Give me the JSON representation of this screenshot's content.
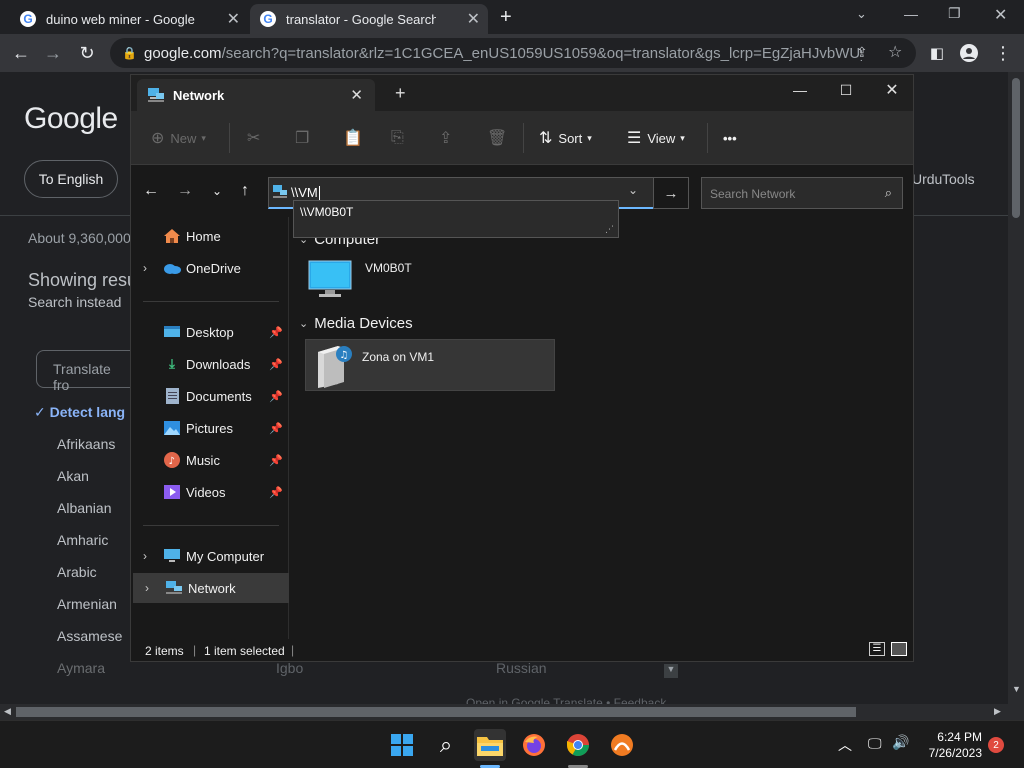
{
  "browser": {
    "tabs": [
      {
        "label": "duino web miner - Google Search"
      },
      {
        "label": "translator - Google Search"
      }
    ],
    "url_host": "google.com",
    "url_rest": "/search?q=translator&rlz=1C1GCEA_enUS1059US1059&oq=translator&gs_lcrp=EgZjaHJvbWUyBgg..."
  },
  "google": {
    "logo": "Google",
    "to_english": "To English",
    "about": "About 9,360,000",
    "showing": "Showing resu",
    "search_instead": "Search instead",
    "translate_placeholder": "Translate fro",
    "detect": "Detect lang",
    "languages": [
      "Afrikaans",
      "Akan",
      "Albanian",
      "Amharic",
      "Arabic",
      "Armenian",
      "Assamese",
      "Aymara"
    ],
    "urdu": "Urdu",
    "tools": "Tools",
    "igbo": "Igbo",
    "russian": "Russian",
    "footer": "Open in Google Translate  •  Feedback"
  },
  "explorer": {
    "tab_title": "Network",
    "cmd": {
      "new": "New",
      "sort": "Sort",
      "view": "View",
      "more": "•••"
    },
    "address_value": "\\\\VM",
    "address_suggestion": "\\\\VM0B0T",
    "search_placeholder": "Search Network",
    "nav": {
      "home": "Home",
      "onedrive": "OneDrive",
      "desktop": "Desktop",
      "downloads": "Downloads",
      "documents": "Documents",
      "pictures": "Pictures",
      "music": "Music",
      "videos": "Videos",
      "my_computer": "My Computer",
      "network": "Network"
    },
    "groups": {
      "computer": "Computer",
      "media": "Media Devices"
    },
    "items": {
      "computer": "VM0B0T",
      "media": "Zona on VM1"
    },
    "status": {
      "count": "2 items",
      "selected": "1 item selected"
    }
  },
  "taskbar": {
    "time": "6:24 PM",
    "date": "7/26/2023",
    "badge": "2"
  },
  "colors": {
    "accent": "#6cb8ff",
    "chrome_dark": "#202124",
    "explorer_bg": "#191919"
  }
}
